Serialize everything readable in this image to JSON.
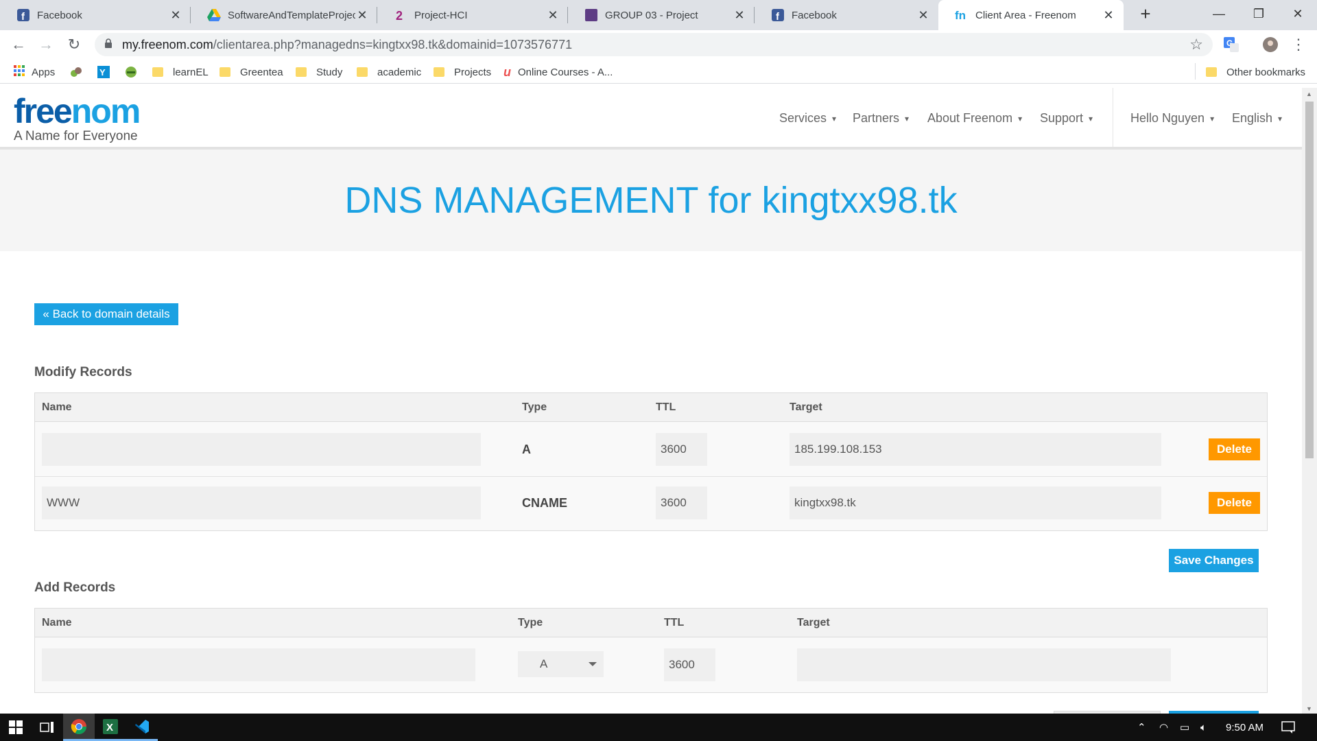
{
  "browser": {
    "tabs": [
      {
        "title": "Facebook",
        "icon": "facebook-icon",
        "active": false
      },
      {
        "title": "SoftwareAndTemplateProject",
        "icon": "google-drive-icon",
        "active": false
      },
      {
        "title": "Project-HCI",
        "icon": "project-2-icon",
        "active": false
      },
      {
        "title": "GROUP 03 - Project",
        "icon": "group-project-icon",
        "active": false
      },
      {
        "title": "Facebook",
        "icon": "facebook-icon",
        "active": false
      },
      {
        "title": "Client Area - Freenom",
        "icon": "freenom-icon",
        "active": true
      }
    ],
    "new_tab": "+",
    "url_host": "my.freenom.com",
    "url_path": "/clientarea.php?managedns=kingtxx98.tk&domainid=1073576771",
    "bookmarks": [
      {
        "label": "Apps",
        "icon": "apps-grid-icon"
      },
      {
        "label": "",
        "icon": "bookmark-icon"
      },
      {
        "label": "",
        "icon": "bookmark-icon"
      },
      {
        "label": "",
        "icon": "bookmark-icon"
      },
      {
        "label": "learnEL",
        "icon": "folder-icon"
      },
      {
        "label": "Greentea",
        "icon": "folder-icon"
      },
      {
        "label": "Study",
        "icon": "folder-icon"
      },
      {
        "label": "academic",
        "icon": "folder-icon"
      },
      {
        "label": "Projects",
        "icon": "folder-icon"
      },
      {
        "label": "Online Courses - A...",
        "icon": "udemy-icon"
      }
    ],
    "other_bookmarks": "Other bookmarks"
  },
  "site": {
    "logo_text": "freenom",
    "tagline": "A Name for Everyone",
    "menu": [
      "Services",
      "Partners",
      "About Freenom",
      "Support"
    ],
    "user_menu": "Hello Nguyen",
    "language": "English"
  },
  "hero_title": "DNS MANAGEMENT for kingtxx98.tk",
  "back_button": "« Back to domain details",
  "modify": {
    "title": "Modify Records",
    "headers": [
      "Name",
      "Type",
      "TTL",
      "Target"
    ],
    "rows": [
      {
        "name": "",
        "type": "A",
        "ttl": "3600",
        "target": "185.199.108.153",
        "action": "Delete"
      },
      {
        "name": "WWW",
        "type": "CNAME",
        "ttl": "3600",
        "target": "kingtxx98.tk",
        "action": "Delete"
      }
    ],
    "save_button": "Save Changes"
  },
  "add": {
    "title": "Add Records",
    "headers": [
      "Name",
      "Type",
      "TTL",
      "Target"
    ],
    "row": {
      "name": "",
      "type": "A",
      "ttl": "3600",
      "target": ""
    }
  },
  "taskbar": {
    "time": "9:50 AM"
  },
  "colors": {
    "accent": "#1ba1e2",
    "delete": "#ff9800",
    "logo_dark": "#0b5ea8"
  }
}
